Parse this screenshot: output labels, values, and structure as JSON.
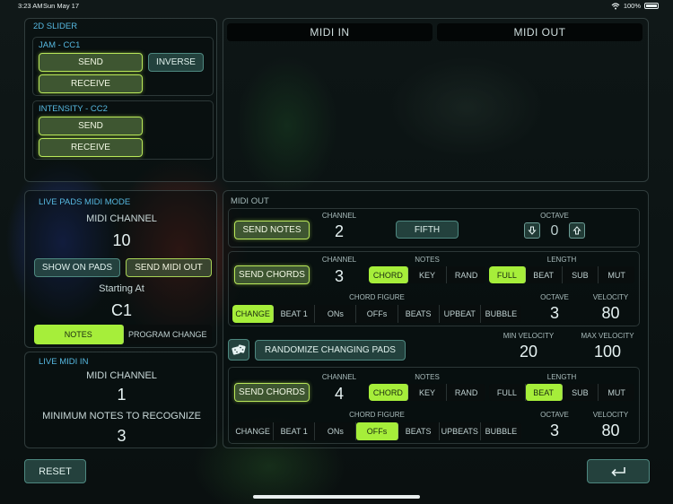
{
  "status": {
    "time": "3:23 AM",
    "date": "Sun May 17",
    "battery": "100%"
  },
  "slider2d": {
    "title": "2D SLIDER",
    "jam": {
      "title": "JAM - CC1",
      "send": "SEND",
      "inverse": "INVERSE",
      "receive": "RECEIVE"
    },
    "intensity": {
      "title": "INTENSITY - CC2",
      "send": "SEND",
      "receive": "RECEIVE"
    }
  },
  "monitor": {
    "midi_in": "MIDI IN",
    "midi_out": "MIDI OUT"
  },
  "live_pads": {
    "title": "LIVE PADS MIDI MODE",
    "channel_label": "MIDI CHANNEL",
    "channel_value": "10",
    "show_on_pads": "SHOW ON PADS",
    "send_midi_out": "SEND MIDI OUT",
    "starting_at_label": "Starting At",
    "starting_at_value": "C1",
    "modes": [
      "NOTES",
      "PROGRAM CHANGE"
    ]
  },
  "live_midi_in": {
    "title": "LIVE MIDI IN",
    "channel_label": "MIDI CHANNEL",
    "channel_value": "1",
    "min_notes_label": "MINIMUM NOTES TO RECOGNIZE",
    "min_notes_value": "3"
  },
  "midi_out": {
    "title": "MIDI OUT",
    "row1": {
      "button": "SEND NOTES",
      "channel_label": "CHANNEL",
      "channel_value": "2",
      "fifth": "FIFTH",
      "octave_label": "OCTAVE",
      "octave_value": "0"
    },
    "row2": {
      "button": "SEND CHORDS",
      "channel_label": "CHANNEL",
      "channel_value": "3",
      "notes_label": "NOTES",
      "notes": [
        "CHORD",
        "KEY",
        "RAND"
      ],
      "length_label": "LENGTH",
      "length": [
        "FULL",
        "BEAT",
        "SUB",
        "MUT"
      ],
      "figure_label": "CHORD FIGURE",
      "figure": [
        "CHANGE",
        "BEAT 1",
        "ONs",
        "OFFs",
        "BEATS",
        "UPBEAT",
        "BUBBLE"
      ],
      "octave_label": "OCTAVE",
      "octave_value": "3",
      "velocity_label": "VELOCITY",
      "velocity_value": "80"
    },
    "randomize": {
      "button": "RANDOMIZE CHANGING PADS",
      "min_velocity_label": "MIN VELOCITY",
      "min_velocity_value": "20",
      "max_velocity_label": "MAX VELOCITY",
      "max_velocity_value": "100"
    },
    "row3": {
      "button": "SEND CHORDS",
      "channel_label": "CHANNEL",
      "channel_value": "4",
      "notes_label": "NOTES",
      "notes": [
        "CHORD",
        "KEY",
        "RAND"
      ],
      "length_label": "LENGTH",
      "length": [
        "FULL",
        "BEAT",
        "SUB",
        "MUT"
      ],
      "figure_label": "CHORD FIGURE",
      "figure": [
        "CHANGE",
        "BEAT 1",
        "ONs",
        "OFFs",
        "BEATS",
        "UPBEATS",
        "BUBBLE"
      ],
      "octave_label": "OCTAVE",
      "octave_value": "3",
      "velocity_label": "VELOCITY",
      "velocity_value": "80"
    }
  },
  "footer": {
    "reset": "RESET"
  },
  "colors": {
    "accent": "#a6ee3a",
    "section_label": "#56b8e0",
    "button_teal": "#2a4e48"
  }
}
